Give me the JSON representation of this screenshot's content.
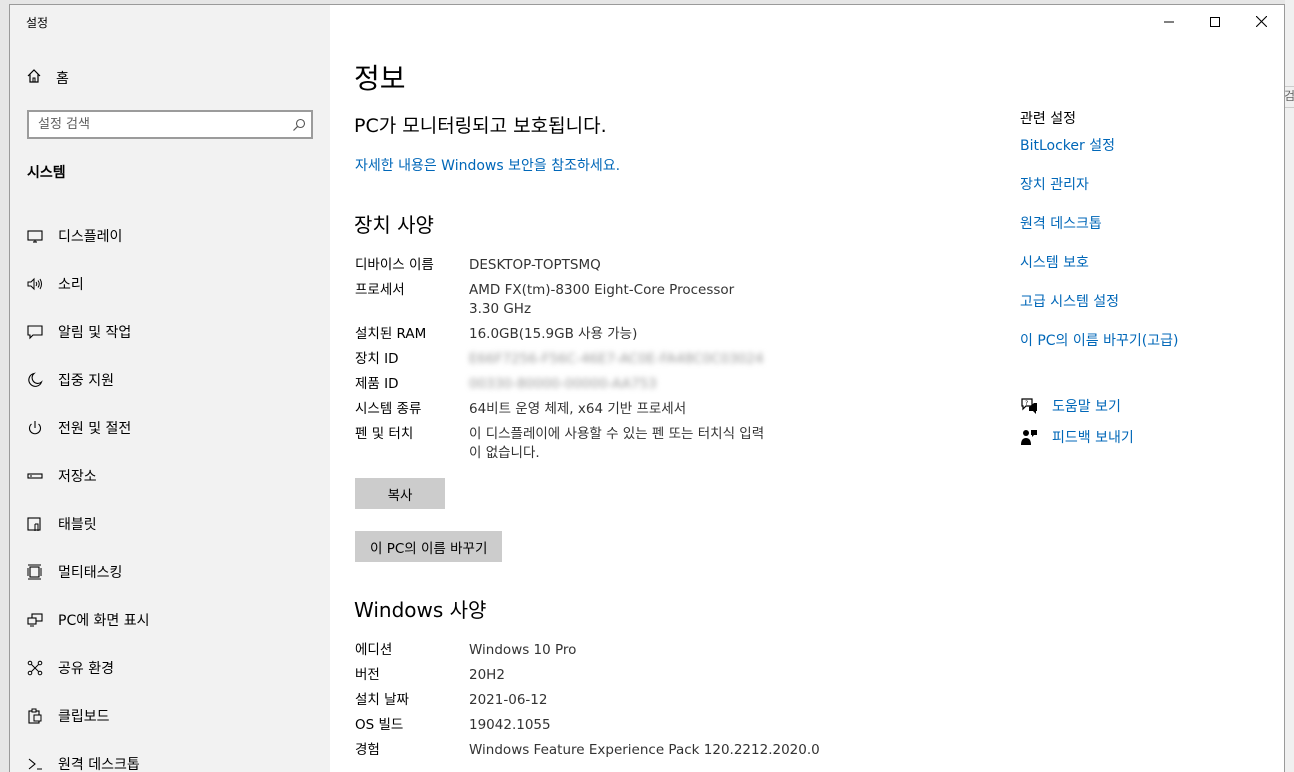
{
  "window": {
    "title": "설정",
    "controls": {
      "minimize_icon": "minimize-icon",
      "maximize_icon": "maximize-icon",
      "close_icon": "close-icon"
    }
  },
  "backdrop": {
    "partial_text": "검"
  },
  "sidebar": {
    "home": {
      "label": "홈",
      "icon": "home-icon"
    },
    "search": {
      "placeholder": "설정 검색",
      "icon": "search-icon"
    },
    "section": "시스템",
    "items": [
      {
        "label": "디스플레이",
        "icon": "display-icon"
      },
      {
        "label": "소리",
        "icon": "sound-icon"
      },
      {
        "label": "알림 및 작업",
        "icon": "notification-icon"
      },
      {
        "label": "집중 지원",
        "icon": "moon-icon"
      },
      {
        "label": "전원 및 절전",
        "icon": "power-icon"
      },
      {
        "label": "저장소",
        "icon": "storage-icon"
      },
      {
        "label": "태블릿",
        "icon": "tablet-icon"
      },
      {
        "label": "멀티태스킹",
        "icon": "multitasking-icon"
      },
      {
        "label": "PC에 화면 표시",
        "icon": "project-icon"
      },
      {
        "label": "공유 환경",
        "icon": "share-icon"
      },
      {
        "label": "클립보드",
        "icon": "clipboard-icon"
      },
      {
        "label": "원격 데스크톱",
        "icon": "remote-desktop-icon"
      }
    ]
  },
  "main": {
    "title": "정보",
    "protection_status": "PC가 모니터링되고 보호됩니다.",
    "security_link": "자세한 내용은 Windows 보안을 참조하세요.",
    "device_specs": {
      "heading": "장치 사양",
      "rows": [
        {
          "key": "디바이스 이름",
          "value": "DESKTOP-TOPTSMQ"
        },
        {
          "key": "프로세서",
          "value": "AMD FX(tm)-8300 Eight-Core Processor",
          "value2": "3.30 GHz"
        },
        {
          "key": "설치된 RAM",
          "value": "16.0GB(15.9GB 사용 가능)"
        },
        {
          "key": "장치 ID",
          "value": "E66F7256-F56C-46E7-AC0E-FA48C0C03024"
        },
        {
          "key": "제품 ID",
          "value": "00330-80000-00000-AA753"
        },
        {
          "key": "시스템 종류",
          "value": "64비트 운영 체제, x64 기반 프로세서"
        },
        {
          "key": "펜 및 터치",
          "value": "이 디스플레이에 사용할 수 있는 펜 또는 터치식 입력",
          "value2": "이 없습니다."
        }
      ],
      "copy_button": "복사",
      "rename_button": "이 PC의 이름 바꾸기"
    },
    "windows_specs": {
      "heading": "Windows 사양",
      "rows": [
        {
          "key": "에디션",
          "value": "Windows 10 Pro"
        },
        {
          "key": "버전",
          "value": "20H2"
        },
        {
          "key": "설치 날짜",
          "value": "2021-06-12"
        },
        {
          "key": "OS 빌드",
          "value": "19042.1055"
        },
        {
          "key": "경험",
          "value": "Windows Feature Experience Pack 120.2212.2020.0"
        }
      ]
    }
  },
  "related": {
    "title": "관련 설정",
    "links": [
      "BitLocker 설정",
      "장치 관리자",
      "원격 데스크톱",
      "시스템 보호",
      "고급 시스템 설정",
      "이 PC의 이름 바꾸기(고급)"
    ],
    "help": {
      "label": "도움말 보기",
      "icon": "help-chat-icon"
    },
    "feedback": {
      "label": "피드백 보내기",
      "icon": "feedback-icon"
    }
  },
  "colors": {
    "link": "#0067b8",
    "sidebar_bg": "#f2f2f2",
    "button_bg": "#cccccc"
  }
}
